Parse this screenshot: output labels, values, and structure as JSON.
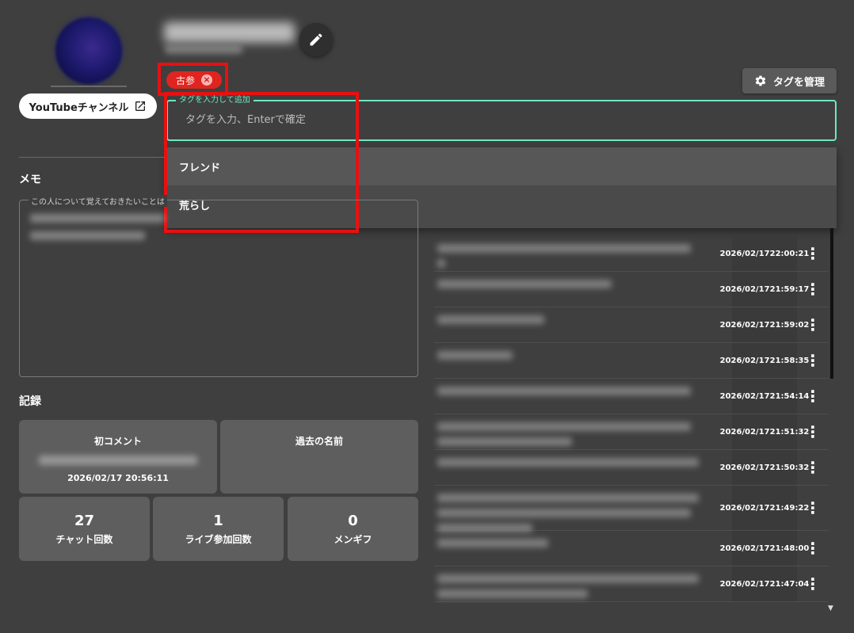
{
  "profile": {
    "youtube_button": "YouTubeチャンネル"
  },
  "tags": {
    "chip_label": "古参",
    "manage_button": "タグを管理",
    "input_label": "タグを入力して追加",
    "input_placeholder": "タグを入力、Enterで確定",
    "options": [
      "フレンド",
      "荒らし"
    ]
  },
  "memo": {
    "title": "メモ",
    "field_label": "この人について覚えておきたいことは"
  },
  "record": {
    "title": "記録",
    "first_comment_title": "初コメント",
    "first_comment_date": "2026/02/17 20:56:11",
    "past_names_title": "過去の名前",
    "stats": [
      {
        "value": "27",
        "label": "チャット回数"
      },
      {
        "value": "1",
        "label": "ライブ参加回数"
      },
      {
        "value": "0",
        "label": "メンギフ"
      }
    ]
  },
  "comments": [
    {
      "date": "2026/02/17",
      "time": "22:00:21"
    },
    {
      "date": "2026/02/17",
      "time": "21:59:17"
    },
    {
      "date": "2026/02/17",
      "time": "21:59:02"
    },
    {
      "date": "2026/02/17",
      "time": "21:58:35"
    },
    {
      "date": "2026/02/17",
      "time": "21:54:14"
    },
    {
      "date": "2026/02/17",
      "time": "21:51:32"
    },
    {
      "date": "2026/02/17",
      "time": "21:50:32"
    },
    {
      "date": "2026/02/17",
      "time": "21:49:22"
    },
    {
      "date": "2026/02/17",
      "time": "21:48:00"
    },
    {
      "date": "2026/02/17",
      "time": "21:47:04"
    }
  ],
  "colors": {
    "background": "#3f3f3f",
    "accent": "#6ee7c3",
    "chip": "#e0241f",
    "highlight": "#e81010"
  }
}
